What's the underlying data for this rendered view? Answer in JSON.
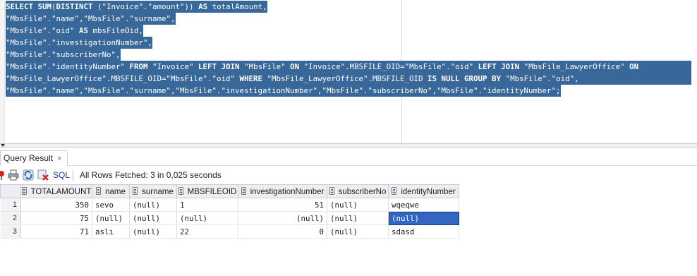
{
  "editor": {
    "lines": [
      [
        {
          "t": "SELECT SUM",
          "k": true
        },
        {
          "t": "(",
          "k": false
        },
        {
          "t": "DISTINCT",
          "k": true
        },
        {
          "t": " (\"Invoice\".\"amount\")) ",
          "k": false
        },
        {
          "t": "AS",
          "k": true
        },
        {
          "t": " totalAmount,",
          "k": false
        }
      ],
      [
        {
          "t": "\"MbsFile\".\"name\",\"MbsFile\".\"surname\",",
          "k": false
        }
      ],
      [
        {
          "t": "\"MbsFile\".\"oid\" ",
          "k": false
        },
        {
          "t": "AS",
          "k": true
        },
        {
          "t": " mbsFileOid,",
          "k": false
        }
      ],
      [
        {
          "t": "\"MbsFile\".\"investigationNumber\",",
          "k": false
        }
      ],
      [
        {
          "t": "\"MbsFile\".\"subscriberNo\",",
          "k": false
        }
      ],
      [
        {
          "t": "\"MbsFile\".\"identityNumber\" ",
          "k": false
        },
        {
          "t": "FROM",
          "k": true
        },
        {
          "t": " \"Invoice\" ",
          "k": false
        },
        {
          "t": "LEFT JOIN",
          "k": true
        },
        {
          "t": " \"MbsFile\" ",
          "k": false
        },
        {
          "t": "ON",
          "k": true
        },
        {
          "t": " \"Invoice\".MBSFILE_OID=\"MbsFile\".\"oid\" ",
          "k": false
        },
        {
          "t": "LEFT JOIN",
          "k": true
        },
        {
          "t": " \"MbsFile_LawyerOffice\" ",
          "k": false
        },
        {
          "t": "ON",
          "k": true
        }
      ],
      [
        {
          "t": "\"MbsFile_LawyerOffice\".MBSFILE_OID=\"MbsFile\".\"oid\" ",
          "k": false
        },
        {
          "t": "WHERE",
          "k": true
        },
        {
          "t": " \"MbsFile_LawyerOffice\".MBSFILE_OID ",
          "k": false
        },
        {
          "t": "IS NULL GROUP BY",
          "k": true
        },
        {
          "t": " \"MbsFile\".\"oid\",",
          "k": false
        }
      ],
      [
        {
          "t": "\"MbsFile\".\"name\",\"MbsFile\".\"surname\",\"MbsFile\".\"investigationNumber\",\"MbsFile\".\"subscriberNo\",\"MbsFile\".\"identityNumber\";",
          "k": false
        }
      ]
    ]
  },
  "results": {
    "tab_label": "Query Result",
    "tab_close": "×",
    "sql_label": "SQL",
    "status": "All Rows Fetched: 3 in 0,025 seconds",
    "columns": [
      "TOTALAMOUNT",
      "name",
      "surname",
      "MBSFILEOID",
      "investigationNumber",
      "subscriberNo",
      "identityNumber"
    ],
    "rows": [
      {
        "num": "1",
        "cells": [
          "350",
          "sevo",
          "(null)",
          "1",
          "51",
          "(null)",
          "wqeqwe"
        ]
      },
      {
        "num": "2",
        "cells": [
          "75",
          "(null)",
          "(null)",
          "(null)",
          "(null)",
          "(null)",
          "(null)"
        ]
      },
      {
        "num": "3",
        "cells": [
          "71",
          "aslı",
          "(null)",
          "22",
          "0",
          "(null)",
          "sdasd"
        ]
      }
    ],
    "selected_cell": {
      "row": 1,
      "col": 6
    }
  },
  "icons": [
    "pin-icon",
    "print-icon",
    "refresh-icon",
    "cancel-query-icon"
  ],
  "colors": {
    "selection": "#38689a",
    "cell_selected": "#3366c2",
    "header_bg": "#eceef1"
  }
}
